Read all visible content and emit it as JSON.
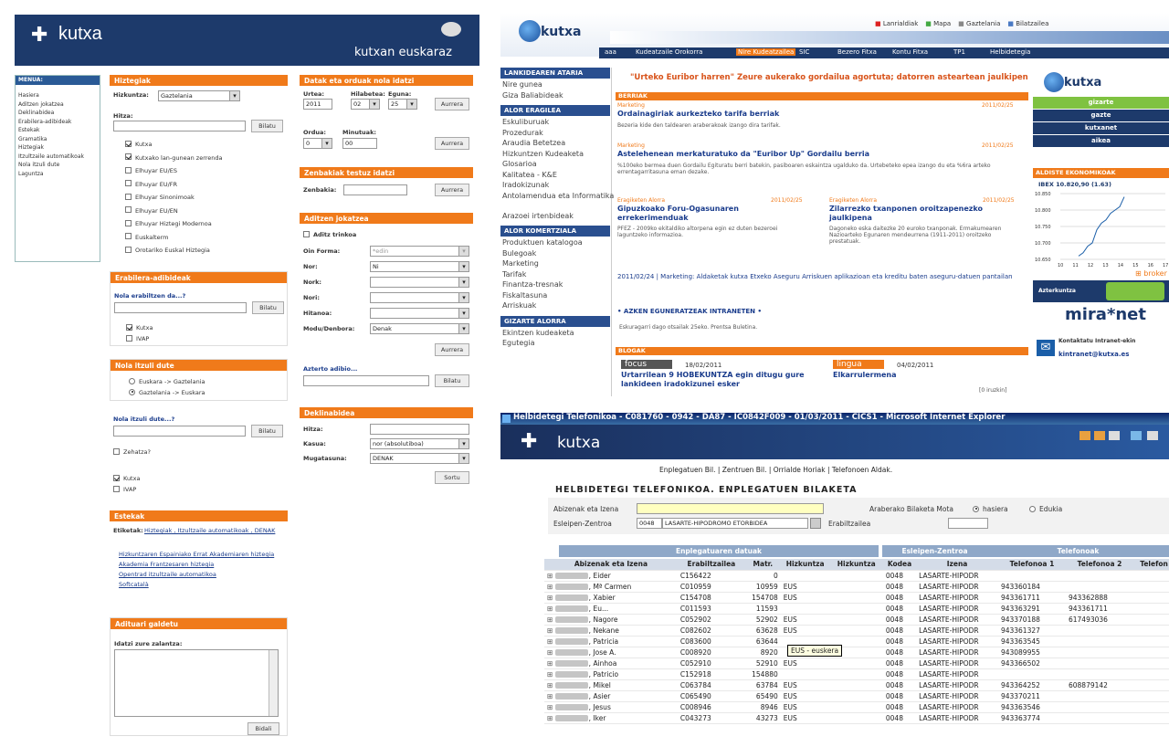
{
  "q1": {
    "logo": "kutxa",
    "euskaraz": "kutxan euskaraz",
    "menu": {
      "title": "MENUA:",
      "items": [
        "Hasiera",
        "Aditzen jokatzea",
        "Deklinabidea",
        "Erabilera-adibideak",
        "Estekak",
        "Gramatika",
        "Hiztegiak",
        "Itzultzaile automatikoak",
        "Nola itzuli dute",
        "Laguntza"
      ]
    },
    "hiztegiak": {
      "title": "Hiztegiak",
      "hizkuntza_label": "Hizkuntza:",
      "hizkuntza_value": "Gaztelania",
      "hitza_label": "Hitza:",
      "button": "Bilatu",
      "options": [
        {
          "label": "Kutxa",
          "on": true
        },
        {
          "label": "Kutxako lan-gunean zerrenda",
          "on": true
        },
        {
          "label": "Elhuyar EU/ES",
          "on": false
        },
        {
          "label": "Elhuyar EU/FR",
          "on": false
        },
        {
          "label": "Elhuyar Sinonimoak",
          "on": false
        },
        {
          "label": "Elhuyar EU/EN",
          "on": false
        },
        {
          "label": "Elhuyar Hiztegi Modernoa",
          "on": false
        },
        {
          "label": "Euskalterm",
          "on": false
        },
        {
          "label": "Orotariko Euskal Hiztegia",
          "on": false
        }
      ]
    },
    "datak": {
      "title": "Datak eta orduak nola idatzi",
      "urtea_label": "Urtea:",
      "urtea": "2011",
      "hilabetea_label": "Hilabetea:",
      "hilabetea": "02",
      "eguna_label": "Eguna:",
      "eguna": "25",
      "aurrera": "Aurrera",
      "ordua_label": "Ordua:",
      "ordua": "0",
      "minutuak_label": "Minutuak:",
      "minutuak": "00",
      "aurrera2": "Aurrera"
    },
    "zenbakiak": {
      "title": "Zenbakiak testuz idatzi",
      "label": "Zenbakia:",
      "button": "Aurrera"
    },
    "aditzen": {
      "title": "Aditzen jokatzea",
      "checkbox": "Aditz trinkoa",
      "rows": [
        {
          "label": "Oin Forma:",
          "value": "*edin"
        },
        {
          "label": "Nor:",
          "value": "Ni"
        },
        {
          "label": "Nork:",
          "value": ""
        },
        {
          "label": "Nori:",
          "value": ""
        },
        {
          "label": "Hitanoa:",
          "value": ""
        },
        {
          "label": "Modu/Denbora:",
          "value": "Denak"
        }
      ],
      "button": "Aurrera"
    },
    "azterketa": {
      "label": "Azterto adibio...",
      "button": "Bilatu"
    },
    "erabilera": {
      "title": "Erabilera-adibideak",
      "label": "Nola erabiltzen da...?",
      "button": "Bilatu",
      "opts": [
        {
          "label": "Kutxa",
          "on": true
        },
        {
          "label": "IVAP",
          "on": false
        }
      ]
    },
    "nola": {
      "title": "Nola itzuli dute",
      "opts": [
        {
          "label": "Euskara -> Gaztelania",
          "on": false
        },
        {
          "label": "Gaztelania -> Euskara",
          "on": true
        }
      ],
      "label2": "Nola itzuli dute...?",
      "button": "Bilatu",
      "zehatza": "Zehatza?",
      "opts2": [
        {
          "label": "Kutxa",
          "on": true
        },
        {
          "label": "IVAP",
          "on": false
        }
      ]
    },
    "deklinabidea": {
      "title": "Deklinabidea",
      "hitza": "Hitza:",
      "kasua": "Kasua:",
      "kasua_value": "nor (absolutiboa)",
      "mugatasuna": "Mugatasuna:",
      "mugatasuna_value": "DENAK",
      "button": "Sortu"
    },
    "estekak": {
      "title": "Estekak",
      "etiketak": "Etiketak:",
      "tags": "Hiztegiak , Itzultzaile automatikoak , DENAK",
      "links": [
        "Hizkuntzaren Espainiako Errat Akademiaren hiztegia",
        "Akademia Frantzesaren hiztegia",
        "Opentrad itzultzaile automatikoa",
        "Softcatalà"
      ]
    },
    "adituari": {
      "title": "Adituari galdetu",
      "label": "Idatzi zure zalantza:",
      "button": "Bidali"
    }
  },
  "q2": {
    "logo": "kutxa",
    "toplinks": [
      "Lanrialdiak",
      "Mapa",
      "Gaztelania",
      "Bilatzailea"
    ],
    "tabs": [
      "aaa",
      "Kudeatzaile Orokorra",
      "Nire Kudeatzailea",
      "SIC",
      "Bezero Fitxa",
      "Kontu Fitxa",
      "TP1",
      "Helbidetegia"
    ],
    "left": [
      {
        "header": "LANKIDEAREN ATARIA",
        "items": [
          "Nire gunea",
          "Giza Baliabideak"
        ]
      },
      {
        "header": "ALOR ERAGILEA",
        "items": [
          "Eskuliburuak",
          "Prozedurak",
          "Araudia Betetzea",
          "Hizkuntzen Kudeaketa",
          "Glosarioa",
          "Kalitatea - K&E",
          "Iradokizunak",
          "Antolamendua eta Informatika",
          "Arazoei irtenbideak"
        ]
      },
      {
        "header": "ALOR KOMERTZIALA",
        "items": [
          "Produktuen katalogoa",
          "Bulegoak",
          "Marketing",
          "Tarifak",
          "Finantza-tresnak",
          "Fiskaltasuna",
          "Arriskuak"
        ]
      },
      {
        "header": "GIZARTE ALORRA",
        "items": [
          "Ekintzen kudeaketa",
          "Egutegia"
        ]
      }
    ],
    "banner": "\"Urteko Euribor harren\" Zeure aukerako gordailua agortuta; datorren asteartean jaulkipen bat",
    "berriak": "BERRIAK",
    "news": [
      {
        "cat": "Marketing",
        "date": "2011/02/25",
        "title": "Ordainagiriak aurkezteko tarifa berriak",
        "text": "Bezeria kide den taldearen araberakoak izango dira tarifak."
      },
      {
        "cat": "Marketing",
        "date": "2011/02/25",
        "title": "Astelehenean merkaturatuko da \"Euribor Up\" Gordailu berria",
        "text": "%100eko bermea duen Gordailu Egituratu berri batekin, pasiboaren eskaintza ugalduko da. Urtebeteko epea izango du eta %6ra arteko errentagarritasuna eman dezake."
      }
    ],
    "news2": [
      {
        "cat": "Eragiketen Alorra",
        "date": "2011/02/25",
        "title": "Gipuzkoako Foru-Ogasunaren errekerimenduak",
        "text": "PFEZ - 2009ko ekitaldiko altorpena egin ez duten bezeroei laguntzeko informazioa."
      },
      {
        "cat": "Eragiketen Alorra",
        "date": "2011/02/25",
        "title": "Zilarrezko txanponen oroitzapenezko jaulkipena",
        "text": "Dagoneko eska daitezke 20 euroko txanponak. Ermakumearen Nazioarteko Egunaren mendeurrena (1911-2011) oroitzeko prestatuak."
      }
    ],
    "notice": "2011/02/24 | Marketing: Aldaketak kutxa Etxeko Aseguru Arriskuen aplikazioan eta kreditu baten aseguru-datuen pantailan",
    "intranet_title": "AZKEN EGUNERATZEAK INTRANETEN",
    "intranet_text": "Eskuragarri dago otsailak 25eko. Prentsa Buletina.",
    "blogak": "BLOGAK",
    "blog": [
      {
        "tag": "focus",
        "date": "18/02/2011",
        "title": "Urtarrilean 9 HOBEKUNTZA egin ditugu gure lankideen iradokizunei esker"
      },
      {
        "tag": "lingua",
        "date": "04/02/2011",
        "title": "Elkarrulermena"
      }
    ],
    "iruzkin": "[0 iruzkin]",
    "right": {
      "logo": "kutxa",
      "links": [
        "gizarte",
        "gazte",
        "kutxanet",
        "aikea"
      ],
      "burtsa_title": "ALDISTE EKONOMIKOAK",
      "ibex": "IBEX 10.820,90 (1.63)",
      "broker": "broker",
      "azterkuntza": "Azterkuntza",
      "mira": "mira*net",
      "kontaktatu": "Kontaktatu Intranet-ekin",
      "email": "kintranet@kutxa.es"
    },
    "chart_data": {
      "type": "line",
      "ylabels": [
        "10.850",
        "10.800",
        "10.750",
        "10.700",
        "10.650"
      ],
      "xlabels": [
        "10",
        "11",
        "12",
        "13",
        "14",
        "15",
        "16",
        "17"
      ],
      "values": [
        10660,
        10670,
        10690,
        10700,
        10740,
        10760,
        10770,
        10790,
        10800,
        10810,
        10840
      ]
    }
  },
  "q4": {
    "titlebar": "Helbidetegi Telefonikoa - C081760 - 0942 - DA87 - IC0842F009 - 01/03/2011 - CICS1 - Microsoft Internet Explorer",
    "logo": "kutxa",
    "nav": "Enplegatuen Bil. | Zentruen Bil. | Orrialde Horiak | Telefonoen Aldak.",
    "heading": "HELBIDETEGI TELEFONIKOA. ENPLEGATUEN BILAKETA",
    "form": {
      "abizenak": "Abizenak eta Izena",
      "zentroa": "Esleipen-Zentroa",
      "zentroa_code": "0048",
      "zentroa_value": "LASARTE-HIPODROMO ETORBIDEA",
      "bilaketa": "Araberako Bilaketa Mota",
      "hasiera": "hasiera",
      "edukia": "Edukia",
      "erabiltzailea": "Erabiltzailea"
    },
    "groups": [
      "Enplegatuaren datuak",
      "Esleipen-Zentroa",
      "Telefonoak"
    ],
    "cols": [
      "Abizenak eta Izena",
      "Erabiltzailea",
      "Matr.",
      "Hizkuntza",
      "Hizkuntza",
      "Kodea",
      "Izena",
      "Telefonoa 1",
      "Telefonoa 2",
      "Telefon"
    ],
    "rows": [
      [
        "Eider",
        "C156422",
        "0",
        "",
        "0048",
        "LASARTE-HIPODR",
        "",
        ""
      ],
      [
        "Mª Carmen",
        "C010959",
        "10959",
        "EUS",
        "0048",
        "LASARTE-HIPODR",
        "943360184",
        ""
      ],
      [
        "Xabier",
        "C154708",
        "154708",
        "EUS",
        "0048",
        "LASARTE-HIPODR",
        "943361711",
        "943362888"
      ],
      [
        "Eu...",
        "C011593",
        "11593",
        "",
        "0048",
        "LASARTE-HIPODR",
        "943363291",
        "943361711"
      ],
      [
        "Nagore",
        "C052902",
        "52902",
        "EUS",
        "0048",
        "LASARTE-HIPODR",
        "943370188",
        "617493036"
      ],
      [
        "Nekane",
        "C082602",
        "63628",
        "EUS",
        "0048",
        "LASARTE-HIPODR",
        "943361327",
        ""
      ],
      [
        "Patricia",
        "C083600",
        "63644",
        "",
        "0048",
        "LASARTE-HIPODR",
        "943363545",
        ""
      ],
      [
        "Jose A.",
        "C008920",
        "8920",
        "",
        "0048",
        "LASARTE-HIPODR",
        "943089955",
        ""
      ],
      [
        "Ainhoa",
        "C052910",
        "52910",
        "EUS",
        "0048",
        "LASARTE-HIPODR",
        "943366502",
        ""
      ],
      [
        "Patricio",
        "C152918",
        "154880",
        "",
        "0048",
        "LASARTE-HIPODR",
        "",
        ""
      ],
      [
        "Mikel",
        "C063784",
        "63784",
        "EUS",
        "0048",
        "LASARTE-HIPODR",
        "943364252",
        "608879142"
      ],
      [
        "Asier",
        "C065490",
        "65490",
        "EUS",
        "0048",
        "LASARTE-HIPODR",
        "943370211",
        ""
      ],
      [
        "Jesus",
        "C008946",
        "8946",
        "EUS",
        "0048",
        "LASARTE-HIPODR",
        "943363546",
        ""
      ],
      [
        "Iker",
        "C043273",
        "43273",
        "EUS",
        "0048",
        "LASARTE-HIPODR",
        "943363774",
        ""
      ]
    ],
    "tooltip": "EUS - euskera"
  }
}
